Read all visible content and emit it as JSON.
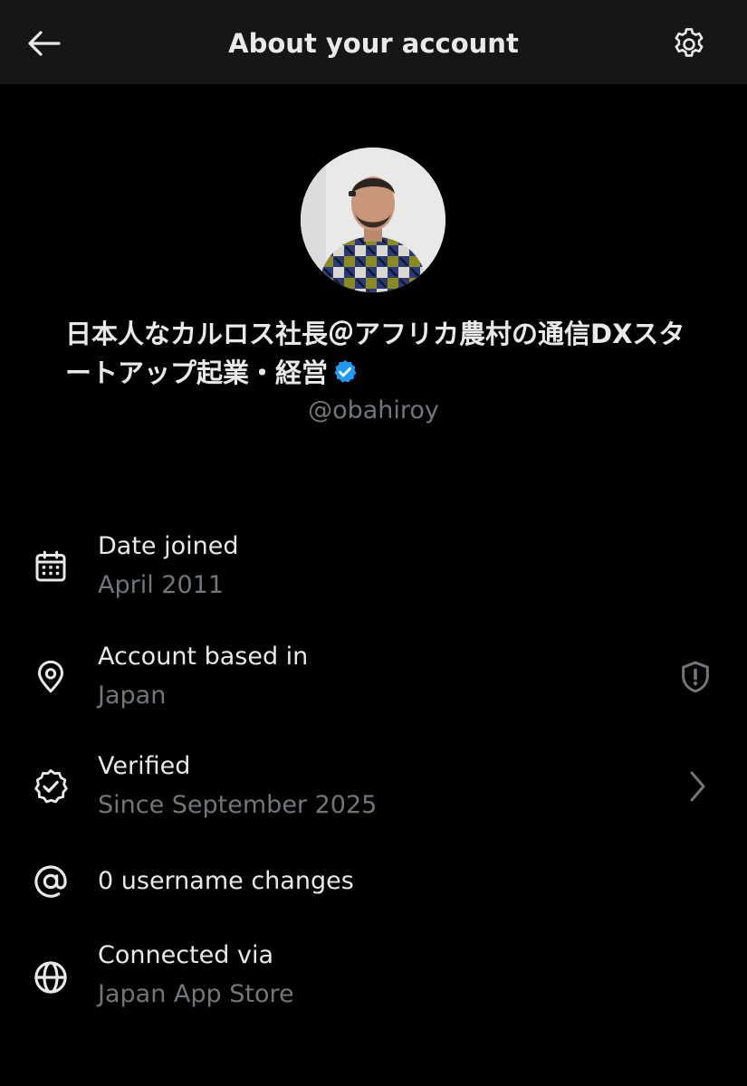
{
  "header": {
    "title": "About your account",
    "back_icon": "arrow-left-icon",
    "settings_icon": "gear-icon"
  },
  "profile": {
    "display_name": "日本人なカルロス社長＠アフリカ農村の通信DXスタートアップ起業・経営",
    "handle": "@obahiroy",
    "verified_icon": "verified-badge-icon",
    "accent_color": "#1d9bf0"
  },
  "details": {
    "date_joined": {
      "title": "Date joined",
      "value": "April 2011",
      "icon": "calendar-icon"
    },
    "account_based_in": {
      "title": "Account based in",
      "value": "Japan",
      "icon": "location-pin-icon",
      "right_icon": "shield-alert-icon"
    },
    "verified": {
      "title": "Verified",
      "value": "Since September 2025",
      "icon": "verified-check-icon",
      "right_icon": "chevron-right-icon"
    },
    "username_changes": {
      "title": "0 username changes",
      "icon": "at-sign-icon"
    },
    "connected_via": {
      "title": "Connected via",
      "value": "Japan App Store",
      "icon": "globe-icon"
    }
  },
  "colors": {
    "background": "#000000",
    "header_background": "#161616",
    "primary_text": "#e7e9ea",
    "secondary_text": "#71767b"
  }
}
